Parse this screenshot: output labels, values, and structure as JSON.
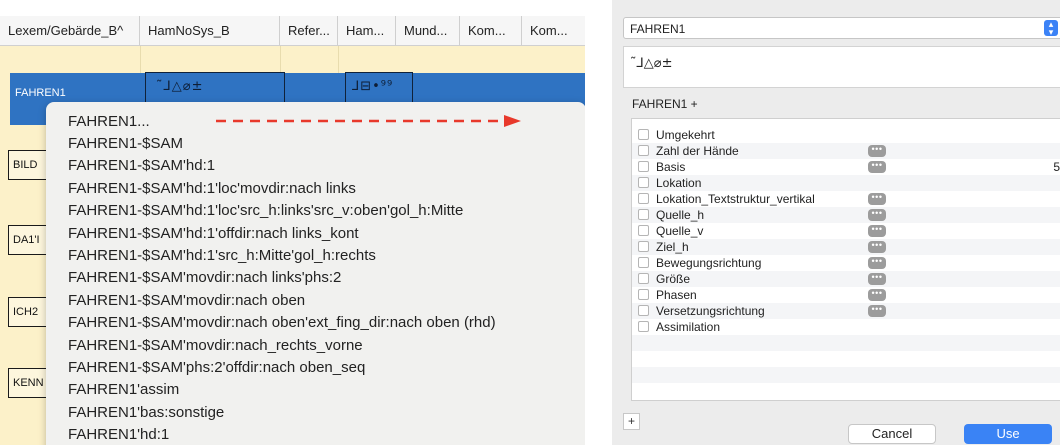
{
  "left_panel": {
    "columns": [
      "Lexem/Gebärde_B^",
      "HamNoSys_B",
      "Refer...",
      "Ham...",
      "Mund...",
      "Kom...",
      "Kom..."
    ],
    "selected_row": {
      "label": "FAHREN1",
      "hamnosys": "˜⅃△⌀±",
      "hamnosys_2": "⅃⊟•⁹⁹"
    },
    "rows": [
      "BILD",
      "DA1'I",
      "ICH2",
      "KENN"
    ],
    "popup_items": [
      "FAHREN1...",
      "FAHREN1-$SAM",
      "FAHREN1-$SAM'hd:1",
      "FAHREN1-$SAM'hd:1'loc'movdir:nach links",
      "FAHREN1-$SAM'hd:1'loc'src_h:links'src_v:oben'gol_h:Mitte",
      "FAHREN1-$SAM'hd:1'offdir:nach links_kont",
      "FAHREN1-$SAM'hd:1'src_h:Mitte'gol_h:rechts",
      "FAHREN1-$SAM'movdir:nach links'phs:2",
      "FAHREN1-$SAM'movdir:nach oben",
      "FAHREN1-$SAM'movdir:nach oben'ext_fing_dir:nach oben (rhd)",
      "FAHREN1-$SAM'movdir:nach_rechts_vorne",
      "FAHREN1-$SAM'phs:2'offdir:nach oben_seq",
      "FAHREN1'assim",
      "FAHREN1'bas:sonstige",
      "FAHREN1'hd:1"
    ],
    "arrow_color": "#e8392b"
  },
  "right_panel": {
    "lexeme_select": "FAHREN1",
    "hamnosys": "˜⅃△⌀±",
    "expression_label": "FAHREN1 +",
    "attributes": [
      {
        "label": "Umgekehrt",
        "has_options": false,
        "value": ""
      },
      {
        "label": "Zahl der Hände",
        "has_options": true,
        "value": ""
      },
      {
        "label": "Basis",
        "has_options": true,
        "value": "5"
      },
      {
        "label": "Lokation",
        "has_options": false,
        "value": ""
      },
      {
        "label": "Lokation_Textstruktur_vertikal",
        "has_options": true,
        "value": ""
      },
      {
        "label": "Quelle_h",
        "has_options": true,
        "value": ""
      },
      {
        "label": "Quelle_v",
        "has_options": true,
        "value": ""
      },
      {
        "label": "Ziel_h",
        "has_options": true,
        "value": ""
      },
      {
        "label": "Bewegungsrichtung",
        "has_options": true,
        "value": ""
      },
      {
        "label": "Größe",
        "has_options": true,
        "value": ""
      },
      {
        "label": "Phasen",
        "has_options": true,
        "value": ""
      },
      {
        "label": "Versetzungsrichtung",
        "has_options": true,
        "value": ""
      },
      {
        "label": "Assimilation",
        "has_options": false,
        "value": ""
      }
    ],
    "more_glyph": "•••",
    "add_label": "+",
    "cancel_label": "Cancel",
    "use_label": "Use",
    "accent_color": "#3a83f5"
  }
}
